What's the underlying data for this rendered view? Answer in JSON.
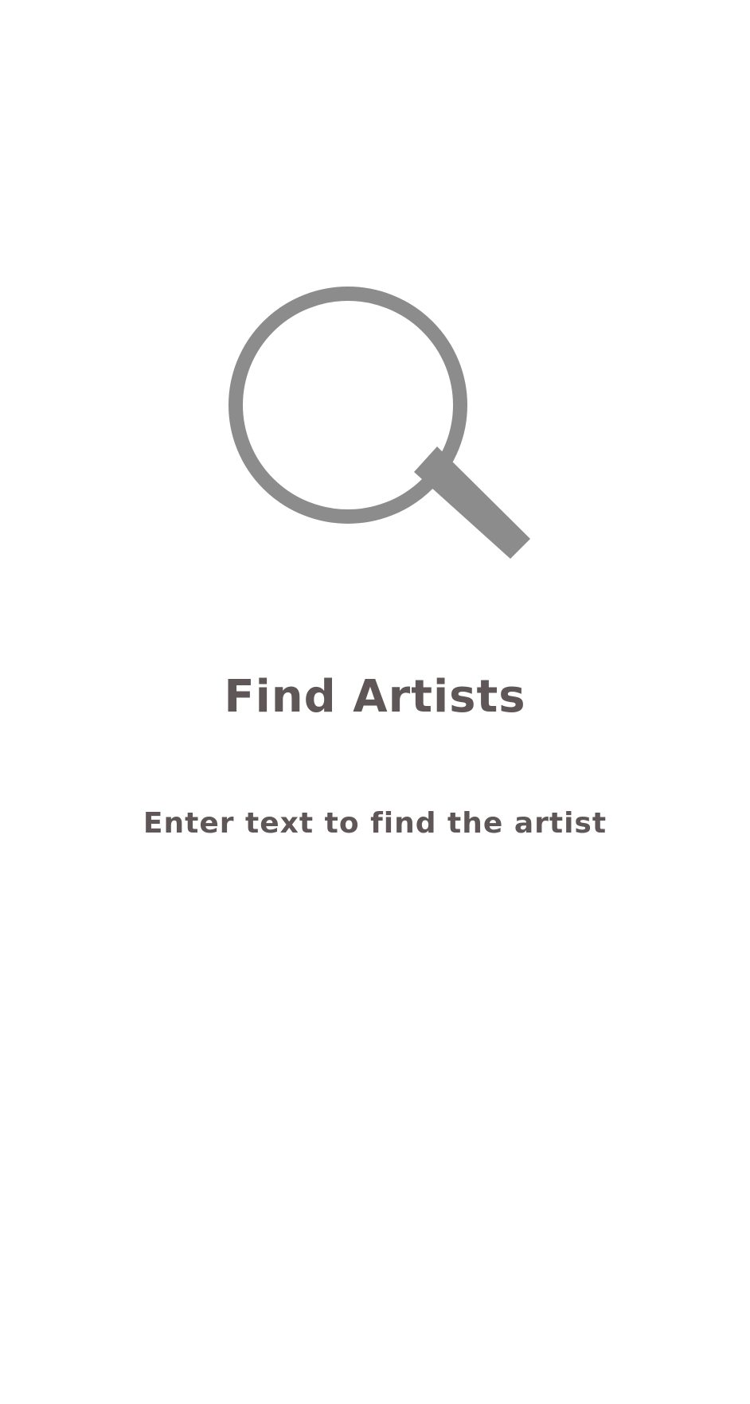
{
  "empty_state": {
    "icon": "search-icon",
    "title": "Find Artists",
    "message": "Enter text to find the artist"
  },
  "colors": {
    "background": "#ffffff",
    "icon": "#8c8c8c",
    "text": "#5f5757"
  }
}
